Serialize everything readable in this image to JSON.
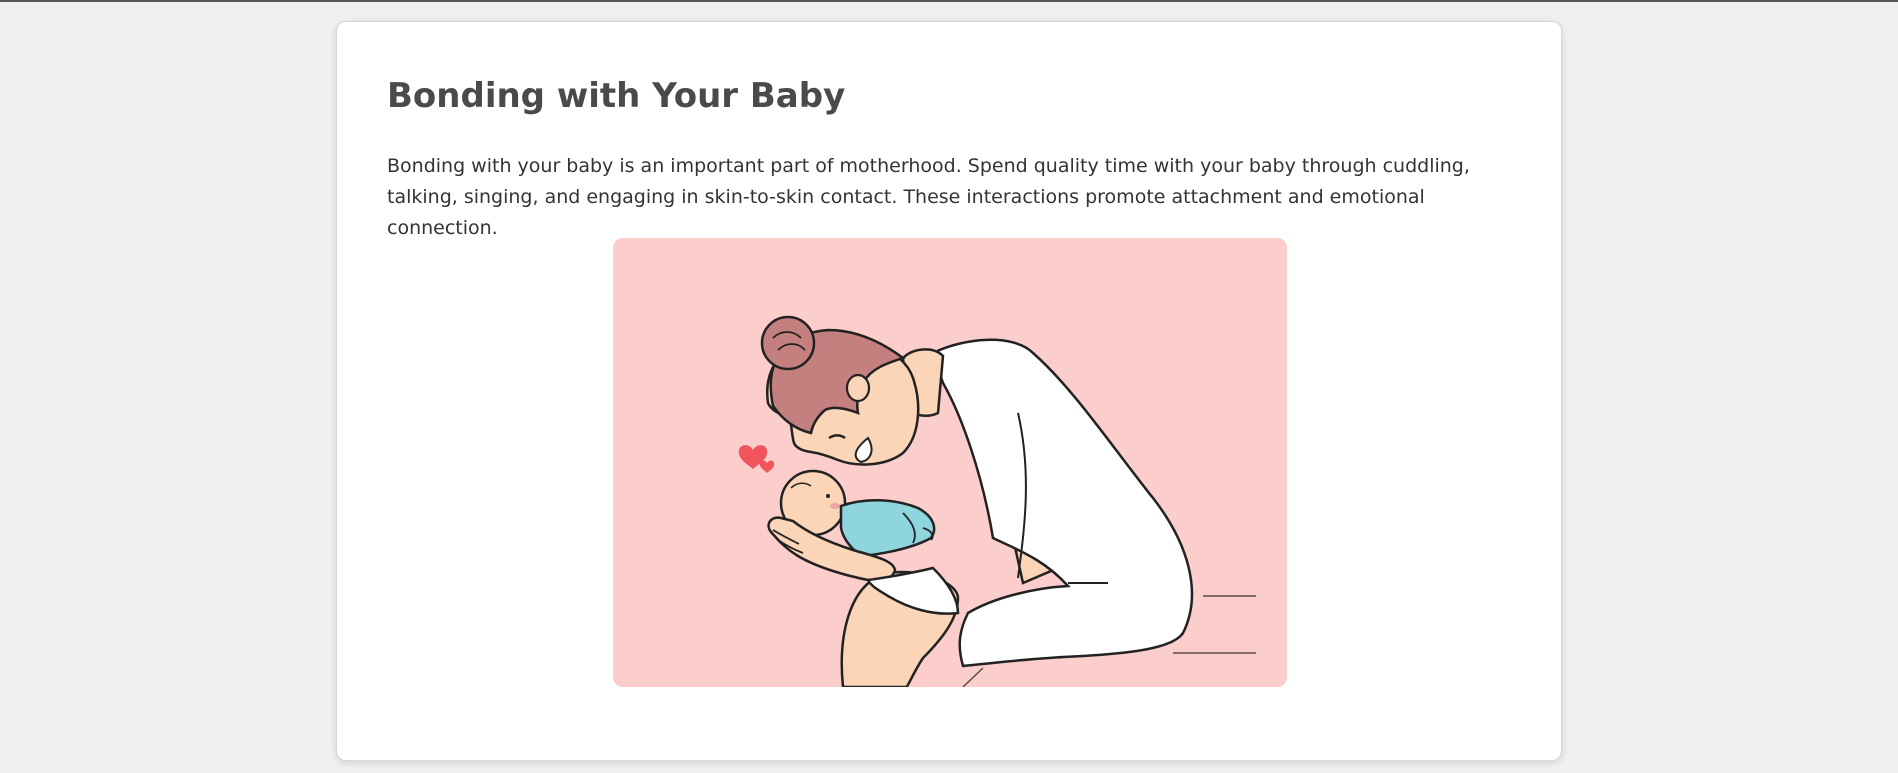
{
  "article": {
    "title": "Bonding with Your Baby",
    "paragraph": "Bonding with your baby is an important part of motherhood. Spend quality time with your baby through cuddling, talking, singing, and engaging in skin-to-skin contact. These interactions promote attachment and emotional connection."
  },
  "illustration": {
    "subject": "mother holding and kissing newborn baby illustration",
    "background_color": "#fccecb",
    "hair_color": "#c47f7f",
    "onesie_color": "#8fd5de",
    "heart_color": "#f0555d",
    "skin_color": "#fad5b8"
  }
}
